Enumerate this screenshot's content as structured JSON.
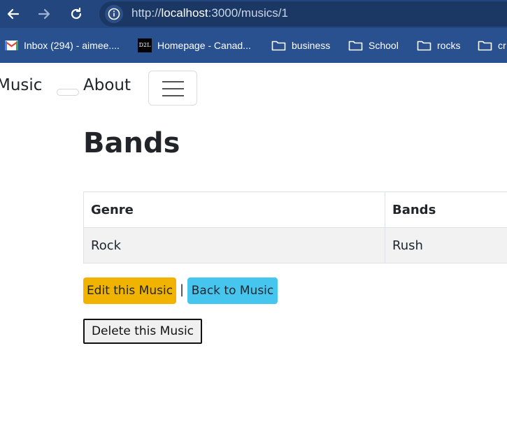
{
  "browser": {
    "url_scheme": "http://",
    "url_host": "localhost",
    "url_path": ":3000/musics/1",
    "bookmarks": [
      {
        "label": "Inbox (294) - aimee....",
        "icon": "gmail-icon"
      },
      {
        "label": "Homepage - Canad...",
        "icon": "d2l-icon",
        "icon_text": "D2L"
      },
      {
        "label": "business",
        "icon": "folder-icon"
      },
      {
        "label": "School",
        "icon": "folder-icon"
      },
      {
        "label": "rocks",
        "icon": "folder-icon"
      },
      {
        "label": "cr",
        "icon": "folder-icon"
      }
    ]
  },
  "navbar": {
    "brand": "Music",
    "about": "About"
  },
  "main": {
    "title": "Bands",
    "table": {
      "headers": [
        "Genre",
        "Bands"
      ],
      "rows": [
        [
          "Rock",
          "Rush"
        ]
      ]
    },
    "edit_label": "Edit this Music",
    "separator": "|",
    "back_label": "Back to Music",
    "delete_label": "Delete this Music"
  },
  "colors": {
    "chrome_top": "#22467d",
    "chrome_bookmarks": "#29508f",
    "edit_button": "#f0b400",
    "back_button": "#46c6ee"
  }
}
